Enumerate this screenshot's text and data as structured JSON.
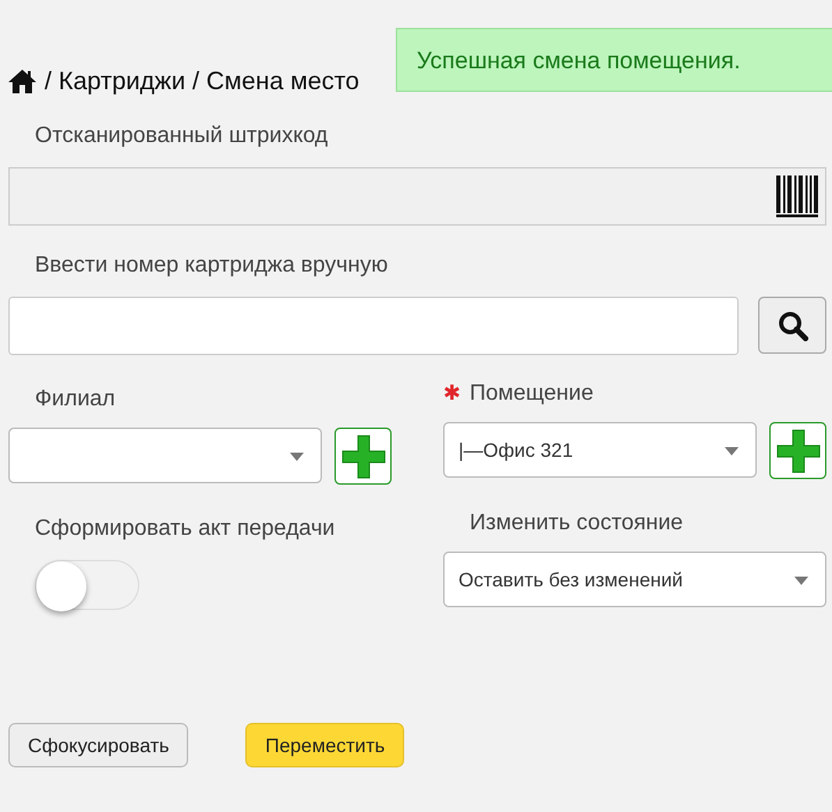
{
  "toast": {
    "text": "Успешная смена помещения."
  },
  "breadcrumb": {
    "text": "/ Картриджи / Смена место"
  },
  "barcode": {
    "label": "Отсканированный штрихкод"
  },
  "manual": {
    "label": "Ввести номер картриджа вручную"
  },
  "branch": {
    "label": "Филиал"
  },
  "room": {
    "label": "Помещение",
    "required": true,
    "required_mark": "✱",
    "value": "|—Офис 321"
  },
  "act": {
    "label": "Сформировать акт передачи",
    "on": false
  },
  "state": {
    "label": "Изменить состояние",
    "value": "Оставить без изменений"
  },
  "buttons": [
    {
      "label": "Сфокусировать",
      "kind": "default"
    },
    {
      "label": "Переместить",
      "kind": "primary"
    }
  ]
}
